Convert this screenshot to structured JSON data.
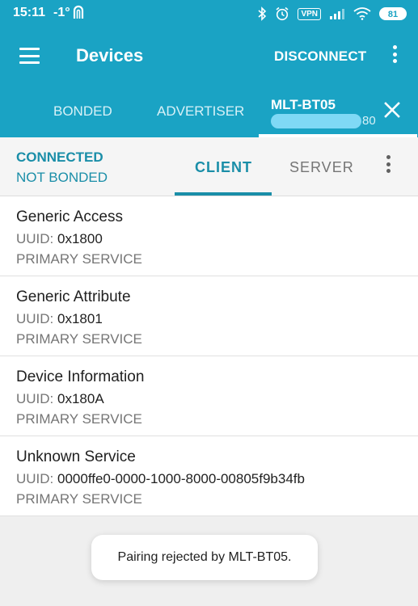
{
  "status_bar": {
    "time": "15:11",
    "temperature": "-1°",
    "vpn": "VPN",
    "battery": "81",
    "icons": [
      "bluetooth-icon",
      "alarm-icon",
      "vpn-icon",
      "signal-icon",
      "wifi-icon",
      "battery-icon"
    ]
  },
  "app_bar": {
    "title": "Devices",
    "disconnect_label": "DISCONNECT"
  },
  "device_tabs": {
    "items": [
      {
        "label": "BONDED"
      },
      {
        "label": "ADVERTISER"
      },
      {
        "label": "MLT-BT05",
        "sub_tail": "80"
      }
    ],
    "selected_index": 2
  },
  "connection": {
    "status": "CONNECTED",
    "bond": "NOT BONDED"
  },
  "role_tabs": {
    "items": [
      {
        "label": "CLIENT"
      },
      {
        "label": "SERVER"
      }
    ],
    "selected_index": 0
  },
  "services": [
    {
      "name": "Generic Access",
      "uuid_label": "UUID:",
      "uuid": "0x1800",
      "type": "PRIMARY SERVICE"
    },
    {
      "name": "Generic Attribute",
      "uuid_label": "UUID:",
      "uuid": "0x1801",
      "type": "PRIMARY SERVICE"
    },
    {
      "name": "Device Information",
      "uuid_label": "UUID:",
      "uuid": "0x180A",
      "type": "PRIMARY SERVICE"
    },
    {
      "name": "Unknown Service",
      "uuid_label": "UUID:",
      "uuid": "0000ffe0-0000-1000-8000-00805f9b34fb",
      "type": "PRIMARY SERVICE"
    }
  ],
  "toast": {
    "message": "Pairing rejected by MLT-BT05."
  },
  "colors": {
    "primary": "#1aa3c4",
    "accent": "#1a8ea8",
    "background": "#efefef"
  }
}
